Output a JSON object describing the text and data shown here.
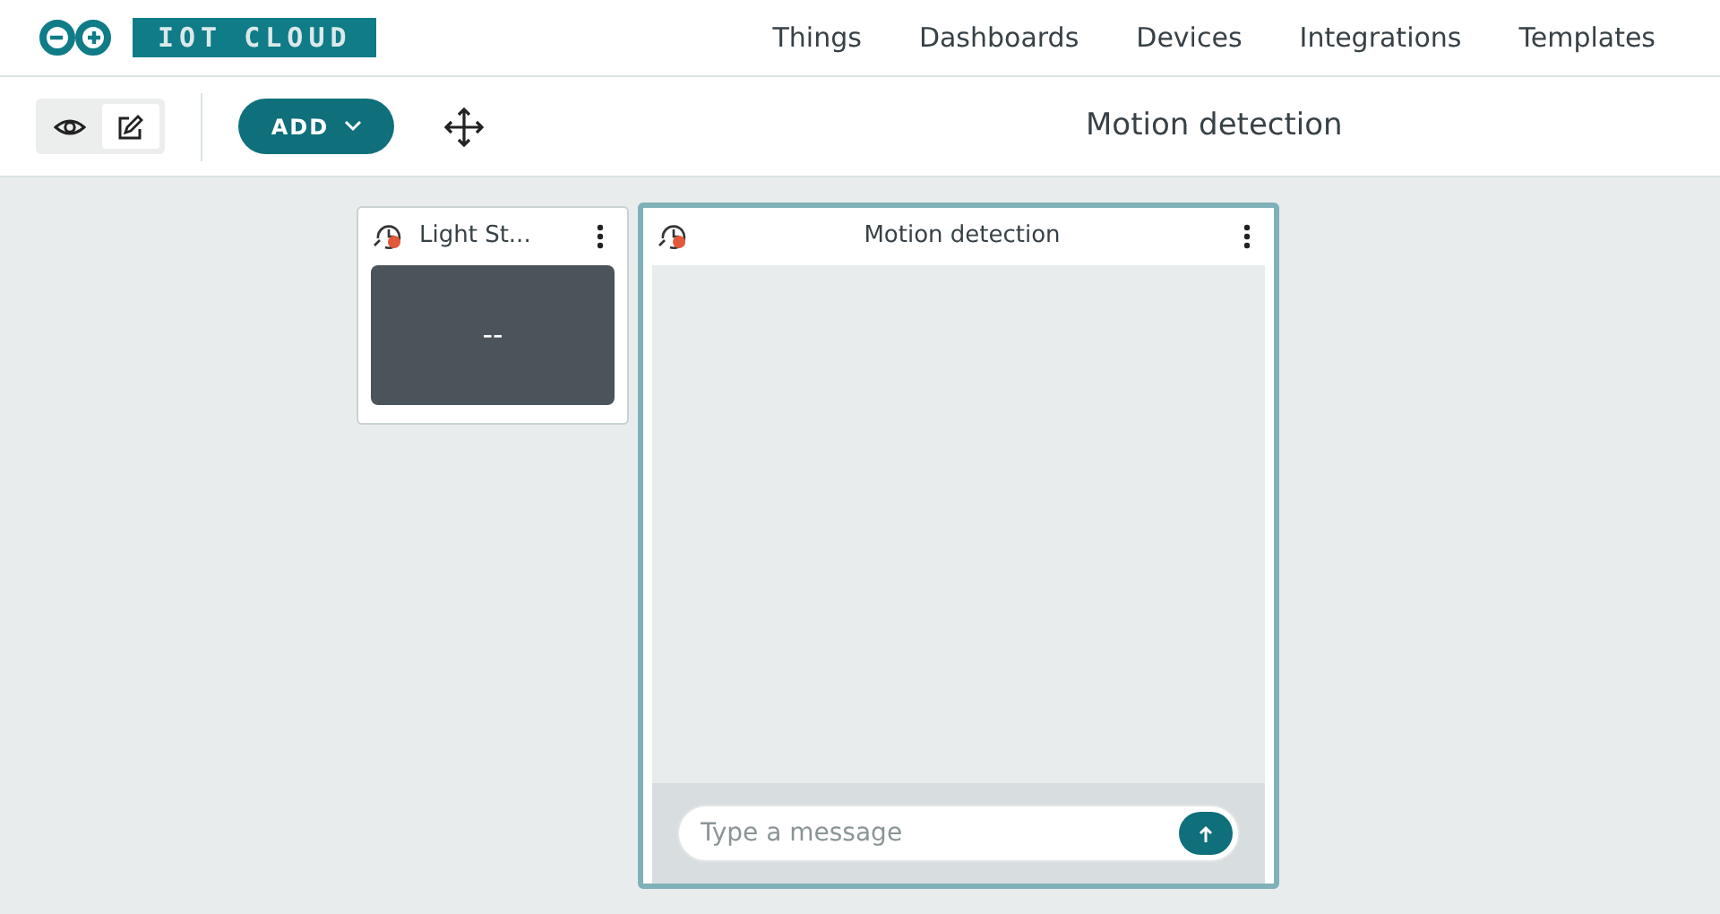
{
  "logo": {
    "text": "IOT CLOUD"
  },
  "nav": [
    {
      "label": "Things"
    },
    {
      "label": "Dashboards"
    },
    {
      "label": "Devices"
    },
    {
      "label": "Integrations"
    },
    {
      "label": "Templates"
    }
  ],
  "toolbar": {
    "modes": [
      {
        "kind": "view",
        "selected": false
      },
      {
        "kind": "edit",
        "selected": true
      }
    ],
    "add_button": "ADD",
    "title": "Motion detection"
  },
  "widgets": [
    {
      "kind": "value",
      "title": "Light St...",
      "value": "--",
      "selected": false
    },
    {
      "kind": "messenger",
      "title": "Motion detection",
      "placeholder": "Type a message",
      "selected": true
    }
  ]
}
